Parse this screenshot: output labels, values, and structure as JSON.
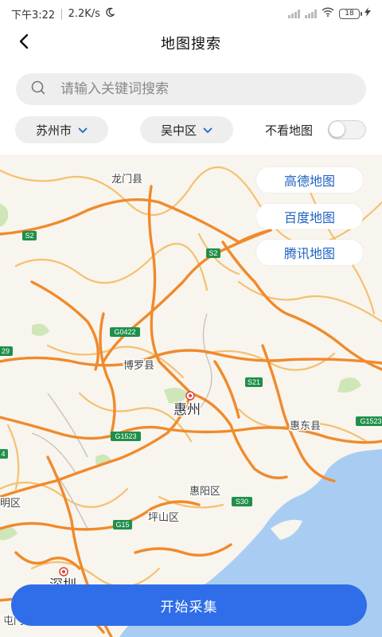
{
  "status_bar": {
    "time": "下午3:22",
    "speed": "2.2K/s",
    "battery": "18"
  },
  "header": {
    "title": "地图搜索",
    "back_icon": "chevron-left-icon"
  },
  "search": {
    "placeholder": "请输入关键词搜索",
    "value": ""
  },
  "filters": {
    "city": "苏州市",
    "district": "吴中区",
    "toggle_label": "不看地图",
    "toggle_on": false
  },
  "map": {
    "place_labels": [
      "龙门县",
      "博罗县",
      "惠州",
      "惠东县",
      "惠阳区",
      "坪山区",
      "明区",
      "深圳",
      "屯门"
    ],
    "road_shields": [
      "S2",
      "S2",
      "G0422",
      "S21",
      "G1523",
      "G1523",
      "S30",
      "G15",
      "29",
      "4"
    ],
    "colors": {
      "land": "#f8f5ee",
      "water": "#a9cdf2",
      "green": "#cfe6b8",
      "highway": "#f08a2c",
      "secondary_road": "#f6c070",
      "shield": "#1f8f4a"
    }
  },
  "providers": {
    "gaode": "高德地图",
    "baidu": "百度地图",
    "tencent": "腾讯地图"
  },
  "start_button": "开始采集",
  "accent_color": "#2f6ee8"
}
